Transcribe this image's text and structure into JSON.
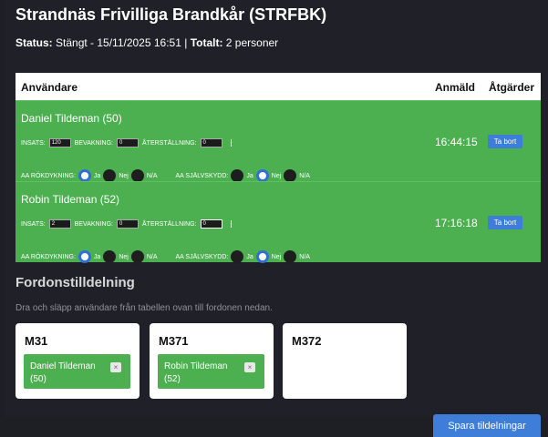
{
  "header": {
    "title": "Strandnäs Frivilliga Brandkår (STRFBK)",
    "status_label": "Status:",
    "status_value": " Stängt - 15/11/2025 16:51 | ",
    "total_label": "Totalt:",
    "total_value": " 2 personer"
  },
  "table": {
    "columns": [
      "Användare",
      "Anmäld",
      "Åtgärder"
    ],
    "rows": [
      {
        "name": "Daniel Tildeman (50)",
        "insats_label": "INSATS:",
        "insats_value": "120",
        "bevakning_label": "BEVAKNING:",
        "bevakning_value": "0",
        "aterstallning_label": "ÅTERSTÄLLNING:",
        "aterstallning_value": "0",
        "rokdykning_label": "AA RÖKDYKNING:",
        "sjalvskydd_label": "AA SJÄLVSKYDD:",
        "opt_ja": "Ja",
        "opt_nej": "Nej",
        "opt_na": "N/A",
        "time": "16:44:15",
        "action": "Ta bort"
      },
      {
        "name": "Robin Tildeman (52)",
        "insats_label": "INSATS:",
        "insats_value": "2",
        "bevakning_label": "BEVAKNING:",
        "bevakning_value": "0",
        "aterstallning_label": "ÅTERSTÄLLNING:",
        "aterstallning_value": "0",
        "rokdykning_label": "AA RÖKDYKNING:",
        "sjalvskydd_label": "AA SJÄLVSKYDD:",
        "opt_ja": "Ja",
        "opt_nej": "Nej",
        "opt_na": "N/A",
        "time": "17:16:18",
        "action": "Ta bort"
      }
    ]
  },
  "vehicles": {
    "title": "Fordonstilldelning",
    "hint": "Dra och släpp användare från tabellen ovan till fordonen nedan.",
    "items": [
      {
        "name": "M31",
        "assigned": "Daniel Tildeman (50)"
      },
      {
        "name": "M371",
        "assigned": "Robin Tildeman (52)"
      },
      {
        "name": "M372",
        "assigned": ""
      }
    ],
    "remove_glyph": "×"
  },
  "save_label": "Spara tildelningar",
  "colors": {
    "row_green": "#4caf50",
    "accent_blue": "#3e7ed8",
    "background": "#202128"
  }
}
